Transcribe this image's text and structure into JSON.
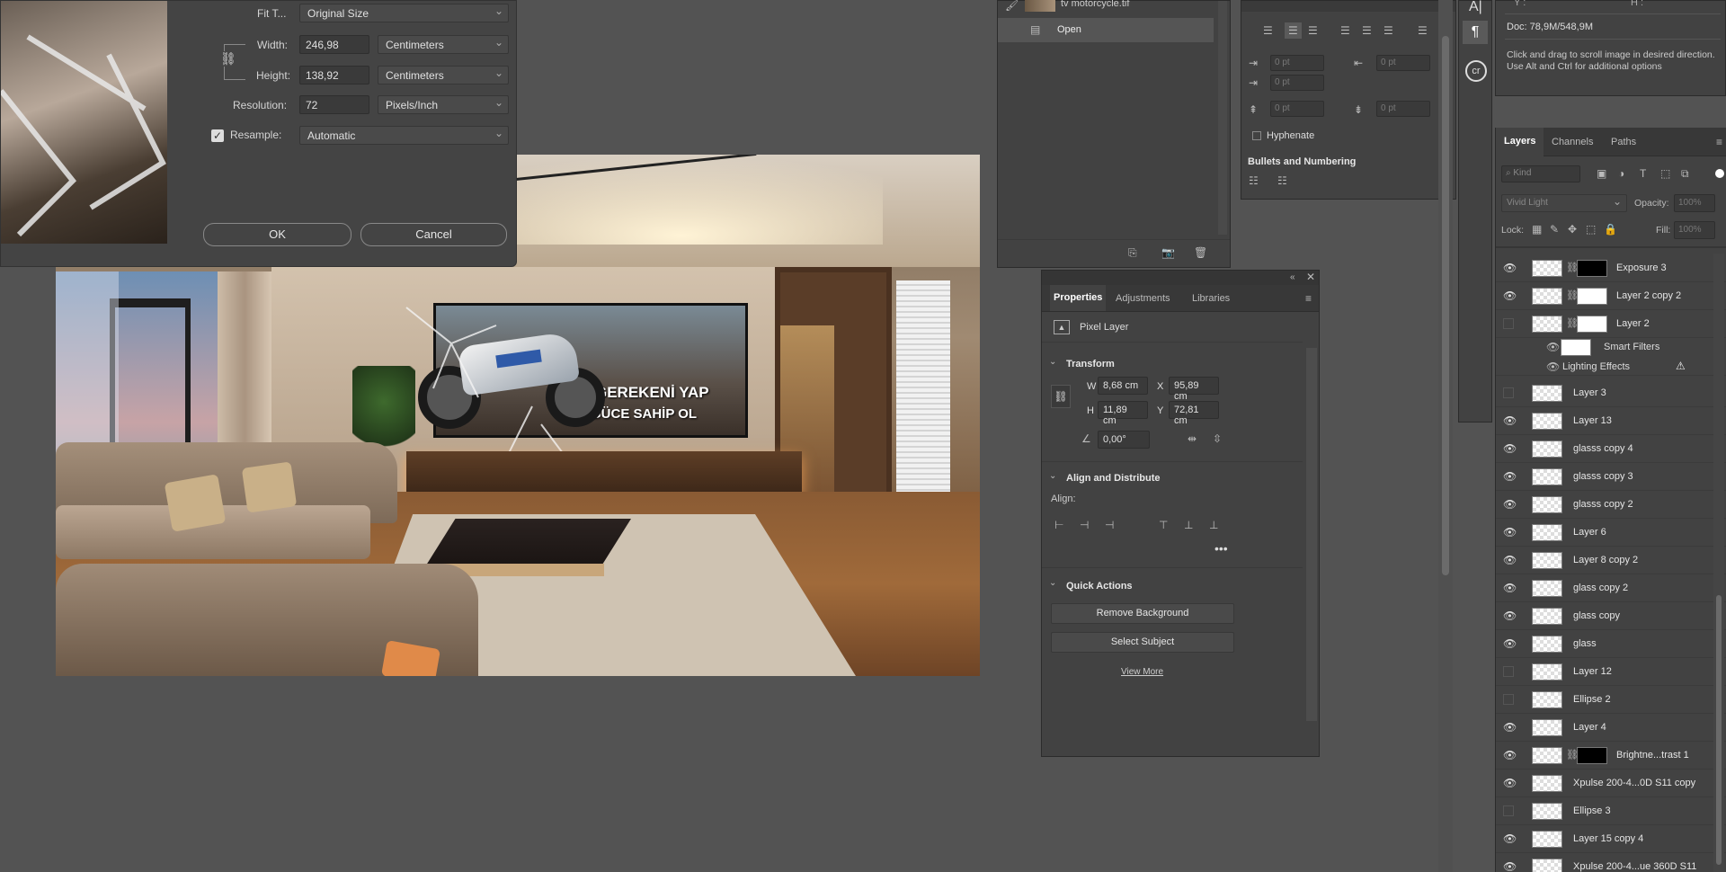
{
  "image_size": {
    "dialog": {
      "fit_to_label": "Fit T...",
      "fit_to_value": "Original Size",
      "width_label": "Width:",
      "width_value": "246,98",
      "width_unit": "Centimeters",
      "height_label": "Height:",
      "height_value": "138,92",
      "height_unit": "Centimeters",
      "resolution_label": "Resolution:",
      "resolution_value": "72",
      "resolution_unit": "Pixels/Inch",
      "resample_label": "Resample:",
      "resample_value": "Automatic",
      "ok_label": "OK",
      "cancel_label": "Cancel"
    }
  },
  "canvas": {
    "banner_line1": "GEREKENİ YAP",
    "banner_line2": "GÜCE SAHİP OL"
  },
  "history": {
    "file_name": "tv motorcycle.tif",
    "open_label": "Open"
  },
  "paragraph": {
    "indent_placeholder": "0 pt",
    "hyphenate_label": "Hyphenate",
    "bullets_label": "Bullets and Numbering"
  },
  "info": {
    "doc_label": "Doc: 78,9M/548,9M",
    "hint": "Click and drag to scroll image in desired direction.  Use Alt and Ctrl for additional options",
    "coord_y": "Y :",
    "coord_h": "H :"
  },
  "properties": {
    "tabs": [
      "Properties",
      "Adjustments",
      "Libraries"
    ],
    "kind": "Pixel Layer",
    "transform_title": "Transform",
    "w_label": "W",
    "w_value": "8,68 cm",
    "x_label": "X",
    "x_value": "95,89 cm",
    "h_label": "H",
    "h_value": "11,89 cm",
    "y_label": "Y",
    "y_value": "72,81 cm",
    "angle_value": "0,00°",
    "align_title": "Align and Distribute",
    "align_label": "Align:",
    "quick_title": "Quick Actions",
    "remove_bg": "Remove Background",
    "select_subject": "Select Subject",
    "view_more": "View More"
  },
  "layers_panel": {
    "tabs": [
      "Layers",
      "Channels",
      "Paths"
    ],
    "kind_placeholder": "Kind",
    "blend_mode": "Vivid Light",
    "opacity_label": "Opacity:",
    "opacity_value": "100%",
    "lock_label": "Lock:",
    "fill_label": "Fill:",
    "fill_value": "100%",
    "smart_filters": "Smart Filters",
    "lighting_effects": "Lighting Effects",
    "layers": [
      {
        "name": "Exposure 3",
        "visible": true
      },
      {
        "name": "Layer 2 copy 2",
        "visible": true
      },
      {
        "name": "Layer 2",
        "visible": false
      },
      {
        "name": "Layer 3",
        "visible": false
      },
      {
        "name": "Layer 13",
        "visible": true
      },
      {
        "name": "glasss copy 4",
        "visible": true
      },
      {
        "name": "glasss copy 3",
        "visible": true
      },
      {
        "name": "glasss copy 2",
        "visible": true
      },
      {
        "name": "Layer 6",
        "visible": true
      },
      {
        "name": "Layer 8 copy 2",
        "visible": true
      },
      {
        "name": "glass copy 2",
        "visible": true
      },
      {
        "name": "glass copy",
        "visible": true
      },
      {
        "name": "glass",
        "visible": true
      },
      {
        "name": "Layer 12",
        "visible": false
      },
      {
        "name": "Ellipse 2",
        "visible": false
      },
      {
        "name": "Layer 4",
        "visible": true
      },
      {
        "name": "Brightne...trast 1",
        "visible": true
      },
      {
        "name": "Xpulse 200-4...0D S11 copy",
        "visible": true
      },
      {
        "name": "Ellipse 3",
        "visible": false
      },
      {
        "name": "Layer 15 copy 4",
        "visible": true
      },
      {
        "name": "Xpulse 200-4...ue  360D S11",
        "visible": true
      }
    ]
  },
  "colors": {
    "bg": "#535353",
    "panel": "#424242",
    "accent": "#1473e6"
  }
}
